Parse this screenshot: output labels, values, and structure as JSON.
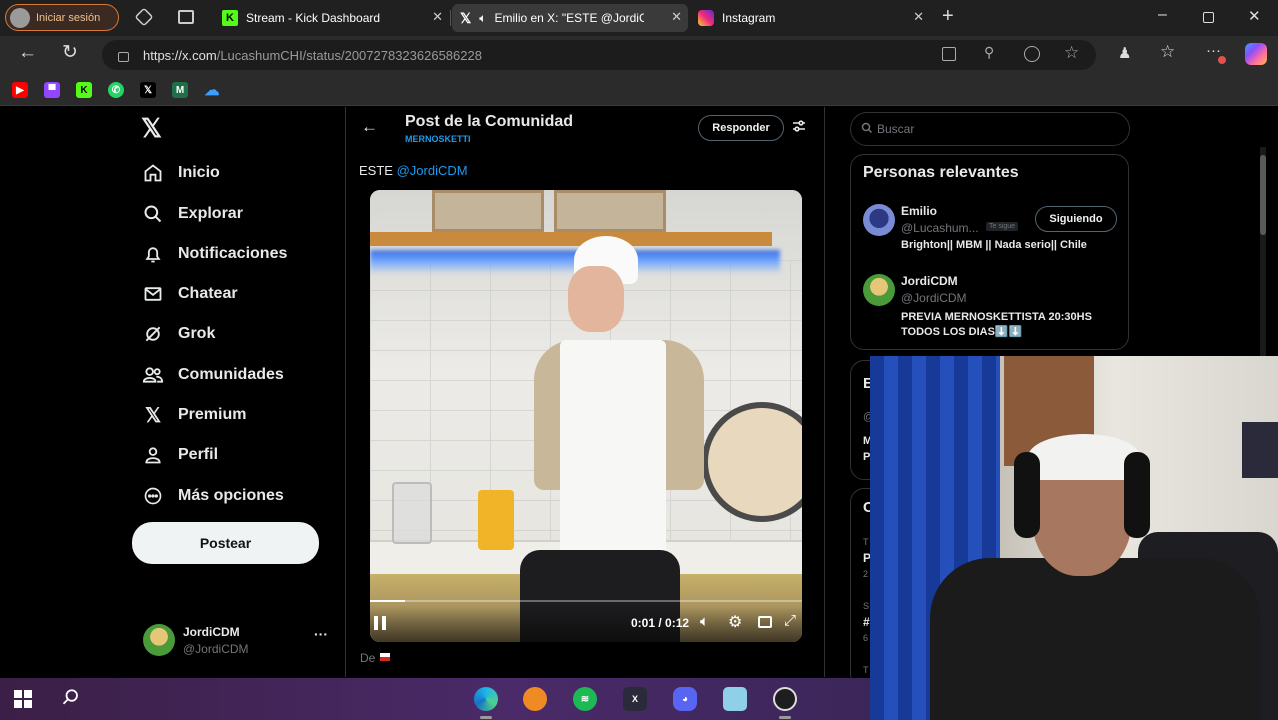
{
  "browser": {
    "signin_label": "Iniciar sesión",
    "tabs": [
      {
        "title": "Stream - Kick Dashboard",
        "active": false
      },
      {
        "title": "Emilio en X: \"ESTE @JordiCDM\"",
        "active": true
      },
      {
        "title": "Instagram",
        "active": false
      }
    ],
    "url_host": "https://x.com",
    "url_path": "/LucashumCHI/status/2007278323626586228"
  },
  "sidebar": {
    "logo": "𝕏",
    "items": [
      {
        "label": "Inicio",
        "icon": "home-icon"
      },
      {
        "label": "Explorar",
        "icon": "search-icon"
      },
      {
        "label": "Notificaciones",
        "icon": "bell-icon"
      },
      {
        "label": "Chatear",
        "icon": "mail-icon"
      },
      {
        "label": "Grok",
        "icon": "grok-icon"
      },
      {
        "label": "Comunidades",
        "icon": "people-icon"
      },
      {
        "label": "Premium",
        "icon": "x-premium-icon"
      },
      {
        "label": "Perfil",
        "icon": "person-icon"
      },
      {
        "label": "Más opciones",
        "icon": "more-circle-icon"
      }
    ],
    "post_button": "Postear",
    "account_name": "JordiCDM",
    "account_handle": "@JordiCDM",
    "account_more": "···"
  },
  "main": {
    "title": "Post de la Comunidad",
    "community": "MERNOSKETTI",
    "reply_button": "Responder",
    "post_text_prefix": "ESTE ",
    "post_mention": "@JordiCDM",
    "video_time": "0:01 / 0:12",
    "video_progress": 0.08,
    "footer_text": "De"
  },
  "right": {
    "search_placeholder": "Buscar",
    "relevant_title": "Personas relevantes",
    "people": [
      {
        "name": "Emilio",
        "handle": "@Lucashum...",
        "follows_you": "Te sigue",
        "bio": "Brighton|| MBM || Nada serio|| Chile",
        "button": "Siguiendo"
      },
      {
        "name": "JordiCDM",
        "handle": "@JordiCDM",
        "bio": "PREVIA MERNOSKETTISTA 20:30HS TODOS LOS DIAS⬇️⬇️"
      }
    ],
    "partial_letters": [
      "E",
      "@",
      "M",
      "P",
      "C",
      "T",
      "P",
      "2",
      "S",
      "#",
      "6",
      "T"
    ]
  },
  "colors": {
    "accent": "#1d9bf0",
    "bg": "#000000",
    "text": "#e7e9ea",
    "muted": "#71767b"
  }
}
